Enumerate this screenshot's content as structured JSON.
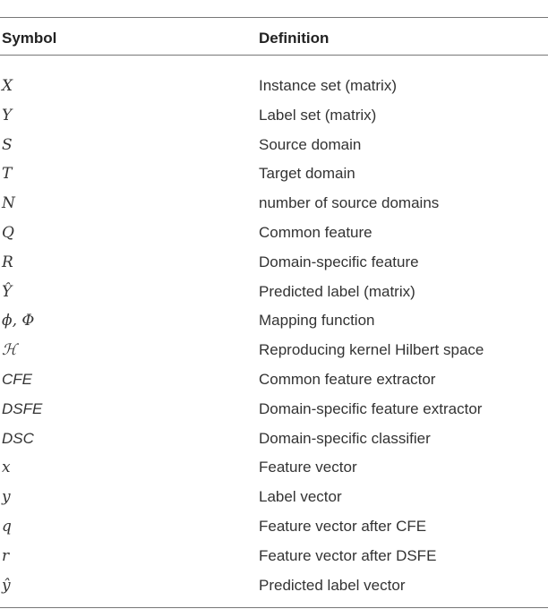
{
  "table": {
    "headers": [
      "Symbol",
      "Definition"
    ],
    "rows": [
      {
        "symbol": "X",
        "definition": "Instance set (matrix)"
      },
      {
        "symbol": "Y",
        "definition": "Label set (matrix)"
      },
      {
        "symbol": "S",
        "definition": "Source domain"
      },
      {
        "symbol": "T",
        "definition": "Target domain"
      },
      {
        "symbol": "N",
        "definition": "number of source domains"
      },
      {
        "symbol": "Q",
        "definition": "Common feature"
      },
      {
        "symbol": "R",
        "definition": "Domain-specific feature"
      },
      {
        "symbol": "Ŷ",
        "definition": "Predicted label (matrix)"
      },
      {
        "symbol": "ϕ, Φ",
        "definition": "Mapping function"
      },
      {
        "symbol": "ℋ",
        "definition": "Reproducing kernel Hilbert space"
      },
      {
        "symbol": "CFE",
        "definition": "Common feature extractor"
      },
      {
        "symbol": "DSFE",
        "definition": "Domain-specific feature extractor"
      },
      {
        "symbol": "DSC",
        "definition": "Domain-specific classifier"
      },
      {
        "symbol": "x",
        "definition": "Feature vector"
      },
      {
        "symbol": "y",
        "definition": "Label vector"
      },
      {
        "symbol": "q",
        "definition": "Feature vector after CFE"
      },
      {
        "symbol": "r",
        "definition": "Feature vector after DSFE"
      },
      {
        "symbol": "ŷ",
        "definition": "Predicted label vector"
      }
    ]
  }
}
